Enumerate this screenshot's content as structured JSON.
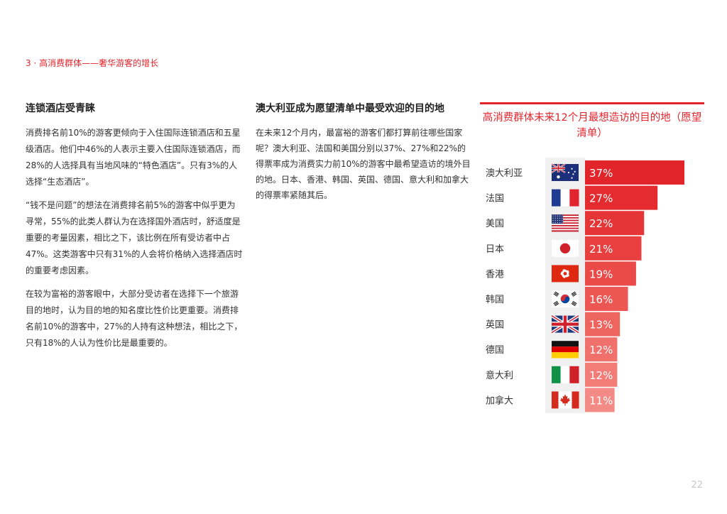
{
  "section_header": "3 · 高消费群体——奢华游客的增长",
  "left_column": {
    "title": "连锁酒店受青睐",
    "paragraphs": [
      "消费排名前10%的游客更倾向于入住国际连锁酒店和五星级酒店。他们中46%的人表示主要入住国际连锁酒店，而28%的人选择具有当地风味的“特色酒店”。只有3%的人选择“生态酒店”。",
      "“钱不是问题”的想法在消费排名前5%的游客中似乎更为寻常，55%的此类人群认为在选择国外酒店时，舒适度是重要的考量因素，相比之下，该比例在所有受访者中占47%。这类游客中只有31%的人会将价格纳入选择酒店时的重要考虑因素。",
      "在较为富裕的游客眼中，大部分受访者在选择下一个旅游目的地时，认为目的地的知名度比性价比更重要。消费排名前10%的游客中，27%的人持有这种想法，相比之下，只有18%的人认为性价比是最重要的。"
    ]
  },
  "middle_column": {
    "title": "澳大利亚成为愿望清单中最受欢迎的目的地",
    "paragraphs": [
      "在未来12个月内，最富裕的游客们都打算前往哪些国家呢？澳大利亚、法国和美国分别以37%、27%和22%的得票率成为消费实力前10%的游客中最希望造访的境外目的地。日本、香港、韩国、英国、德国、意大利和加拿大的得票率紧随其后。"
    ]
  },
  "chart_data": {
    "type": "bar",
    "orientation": "horizontal",
    "title": "高消费群体未来12个月最想造访的目的地（愿望清单）",
    "categories": [
      "澳大利亚",
      "法国",
      "美国",
      "日本",
      "香港",
      "韩国",
      "英国",
      "德国",
      "意大利",
      "加拿大"
    ],
    "values": [
      37,
      27,
      22,
      21,
      19,
      16,
      13,
      12,
      12,
      11
    ],
    "value_labels": [
      "37%",
      "27%",
      "22%",
      "21%",
      "19%",
      "16%",
      "13%",
      "12%",
      "12%",
      "11%"
    ],
    "flags": [
      "australia-flag",
      "france-flag",
      "usa-flag",
      "japan-flag",
      "hong-kong-flag",
      "south-korea-flag",
      "uk-flag",
      "germany-flag",
      "italy-flag",
      "canada-flag"
    ],
    "bar_colors": [
      "#e2242b",
      "#e42c30",
      "#e63537",
      "#e83f3f",
      "#ea4a48",
      "#ec5653",
      "#ee645f",
      "#f0716c",
      "#f27d78",
      "#f48a85"
    ],
    "xlim": [
      0,
      37
    ],
    "grid": false,
    "legend": "none"
  },
  "colors": {
    "accent": "#e2242b"
  },
  "page_number": "22"
}
